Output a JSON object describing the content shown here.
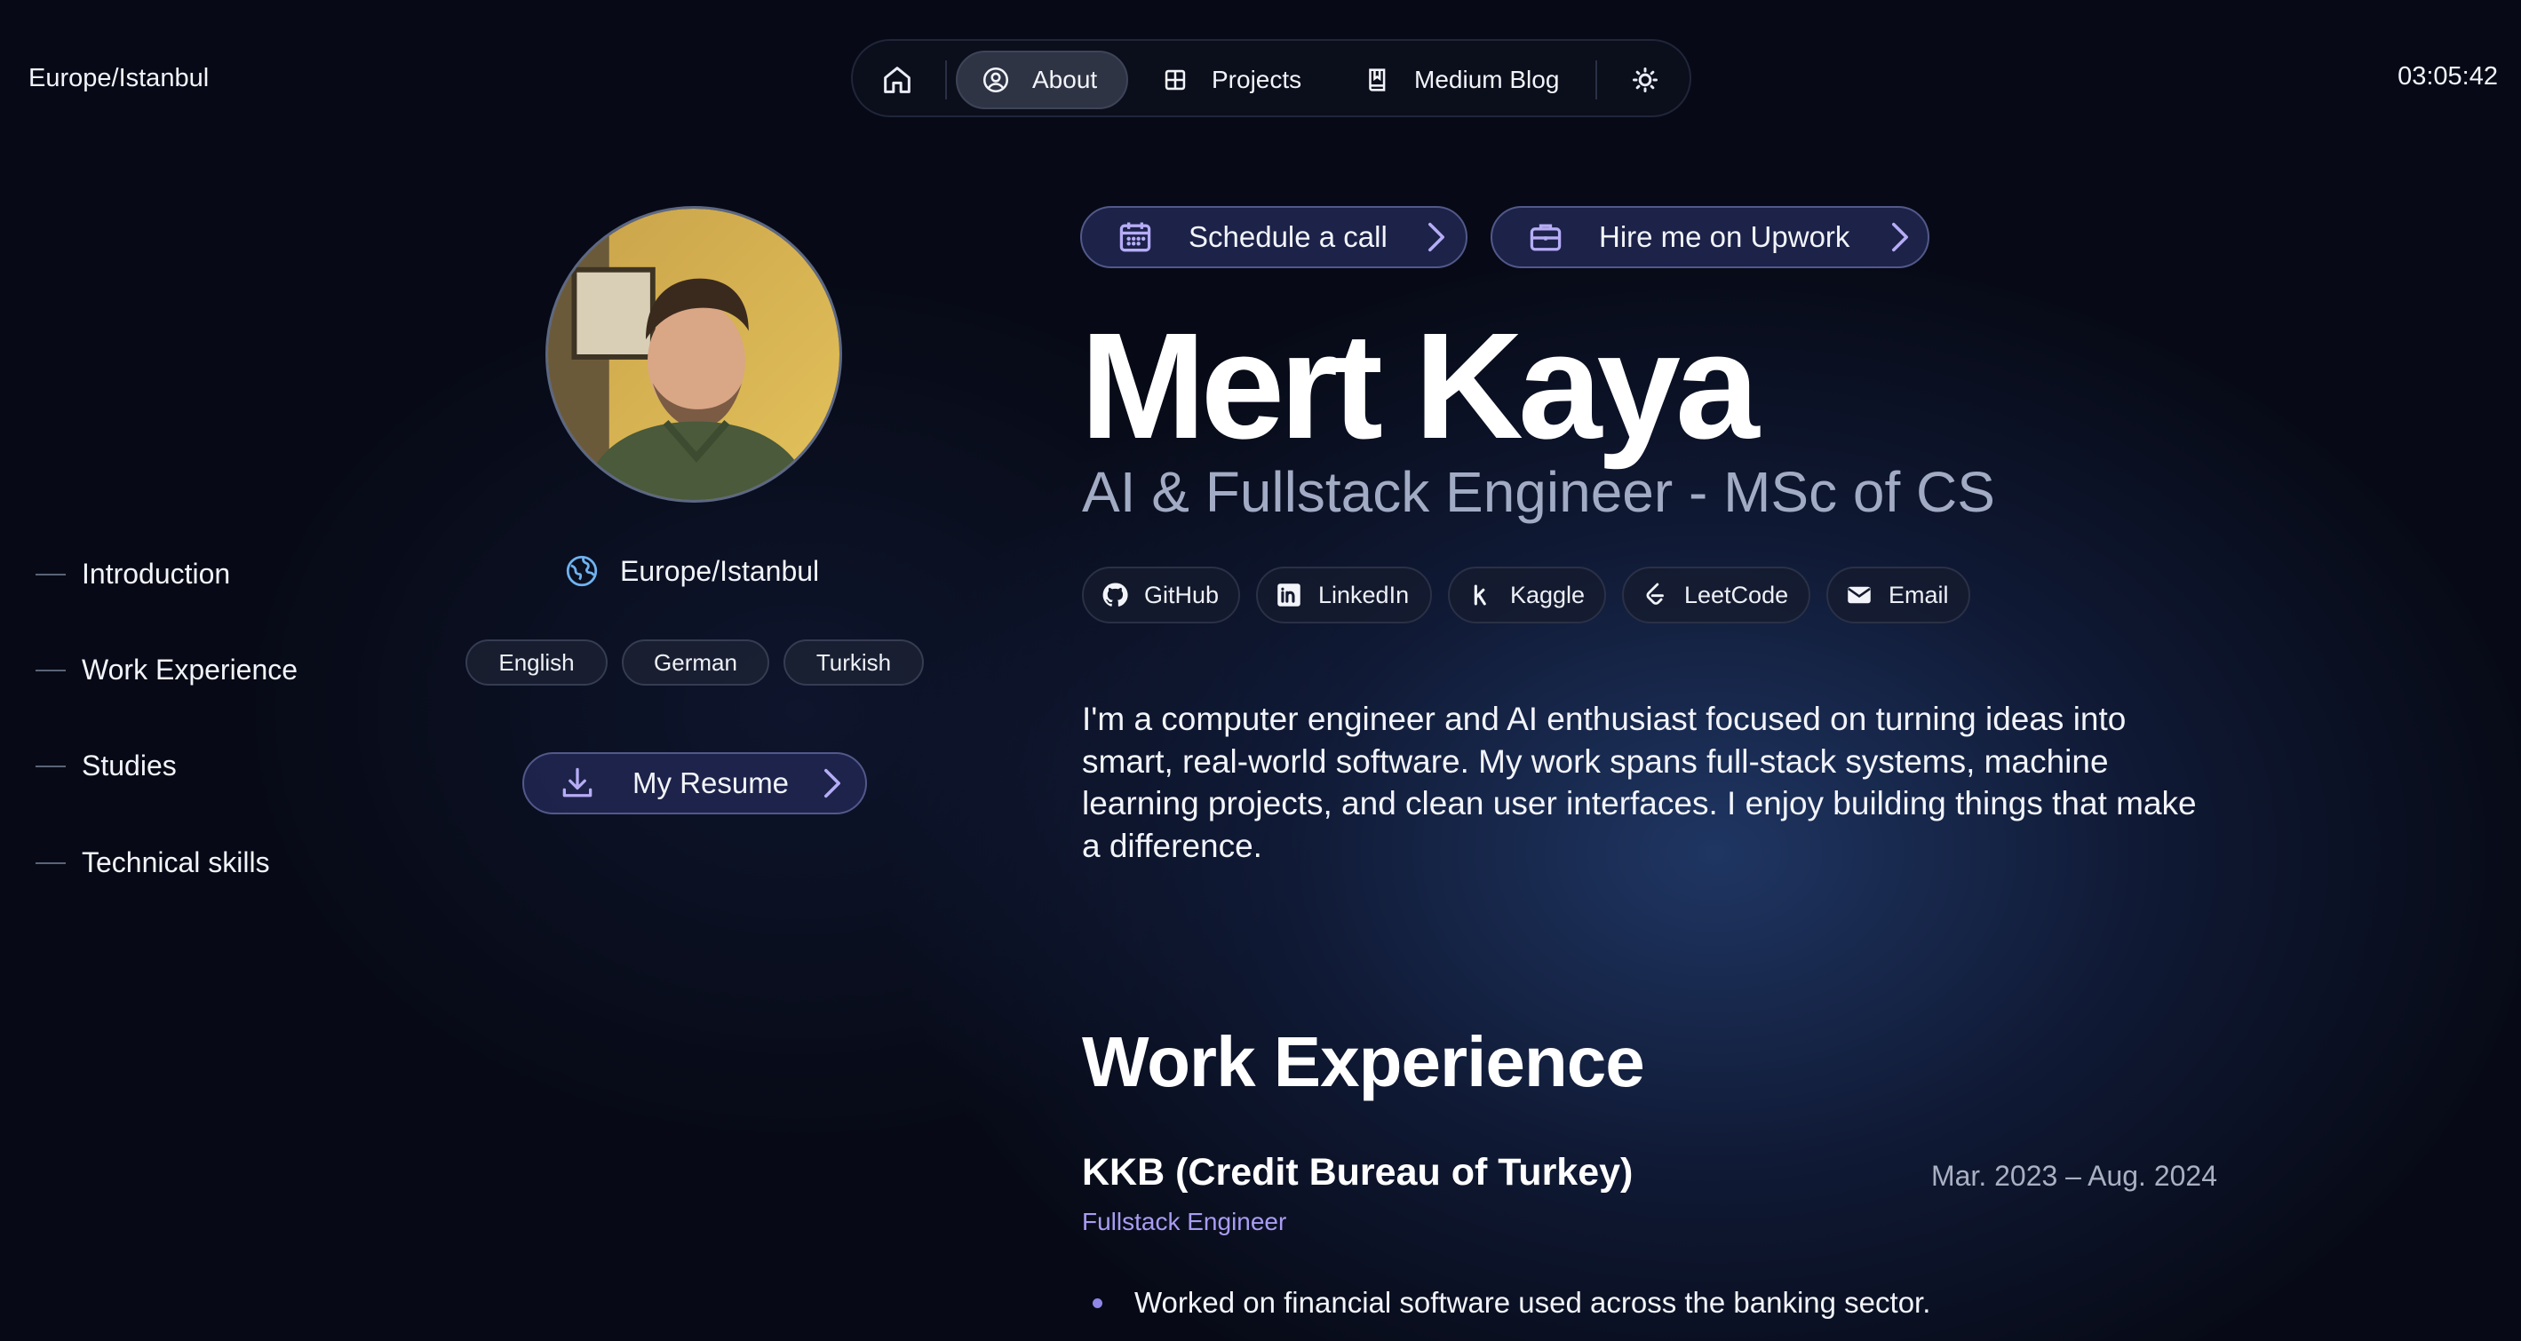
{
  "header": {
    "timezone": "Europe/Istanbul",
    "time": "03:05:42",
    "nav": {
      "home_icon": "home-icon",
      "items": [
        {
          "label": "About",
          "icon": "person-circle-icon",
          "active": true
        },
        {
          "label": "Projects",
          "icon": "grid-icon",
          "active": false
        },
        {
          "label": "Medium Blog",
          "icon": "book-icon",
          "active": false
        }
      ],
      "theme_icon": "sun-icon"
    }
  },
  "toc": {
    "items": [
      {
        "label": "Introduction"
      },
      {
        "label": "Work Experience"
      },
      {
        "label": "Studies"
      },
      {
        "label": "Technical skills"
      }
    ]
  },
  "profile": {
    "location": "Europe/Istanbul",
    "location_icon": "globe-icon",
    "languages": [
      "English",
      "German",
      "Turkish"
    ],
    "resume_label": "My Resume",
    "resume_icon": "download-icon"
  },
  "actions": {
    "schedule_label": "Schedule a call",
    "schedule_icon": "calendar-icon",
    "upwork_label": "Hire me on Upwork",
    "upwork_icon": "briefcase-icon"
  },
  "intro": {
    "name": "Mert Kaya",
    "title": "AI & Fullstack Engineer - MSc of CS",
    "socials": [
      {
        "label": "GitHub",
        "icon": "github-icon"
      },
      {
        "label": "LinkedIn",
        "icon": "linkedin-icon"
      },
      {
        "label": "Kaggle",
        "icon": "kaggle-icon"
      },
      {
        "label": "LeetCode",
        "icon": "leetcode-icon"
      },
      {
        "label": "Email",
        "icon": "email-icon"
      }
    ],
    "bio": "I'm a computer engineer and AI enthusiast focused on turning ideas into smart, real-world software. My work spans full-stack systems, machine learning projects, and clean user interfaces. I enjoy building things that make a difference."
  },
  "work": {
    "heading": "Work Experience",
    "jobs": [
      {
        "company": "KKB (Credit Bureau of Turkey)",
        "dates": "Mar. 2023 – Aug. 2024",
        "role": "Fullstack Engineer",
        "bullets": [
          "Worked on financial software used across the banking sector."
        ]
      }
    ]
  },
  "colors": {
    "background": "#070a16",
    "accent": "#a99cf2",
    "button_bg": "#20264f",
    "muted_text": "#a2abc4"
  }
}
